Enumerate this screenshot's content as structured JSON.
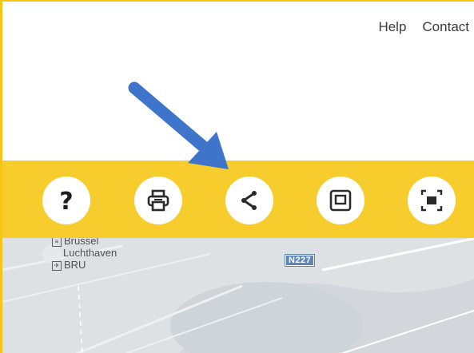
{
  "nav": {
    "help": "Help",
    "contact": "Contact"
  },
  "toolbar": {
    "buttons": [
      {
        "name": "help",
        "icon": "question-mark-icon"
      },
      {
        "name": "print",
        "icon": "printer-icon"
      },
      {
        "name": "share",
        "icon": "share-icon"
      },
      {
        "name": "frame",
        "icon": "frame-icon"
      },
      {
        "name": "fullscreen",
        "icon": "fullscreen-icon"
      }
    ],
    "color": "#f7cd2d"
  },
  "map": {
    "place_line1": "Brussel",
    "place_line2": "Luchthaven",
    "airport_code": "BRU",
    "road": "N227"
  },
  "annotation": {
    "arrow_color": "#3e74c9"
  }
}
